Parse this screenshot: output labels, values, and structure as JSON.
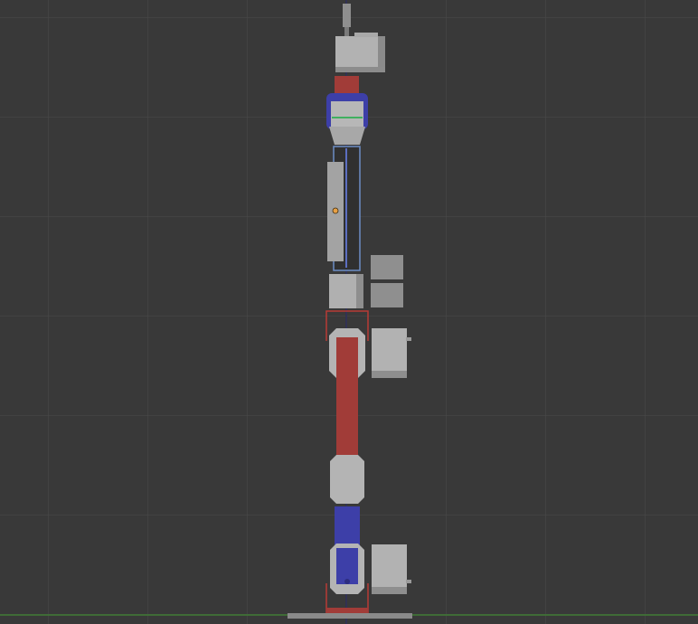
{
  "view": {
    "background_color": "#393939",
    "grid_color": "#464646",
    "x_axis_color": "#3f7a34",
    "z_axis_color": "#2d2d5a",
    "selection_outline_color": "#b73a36",
    "part_gray_color": "#aeaeae",
    "part_red_color": "#a13c38",
    "part_blue_color": "#3d3fa8",
    "origin_marker_color": "#e7a045",
    "indicator_line_color": "#40b060"
  }
}
